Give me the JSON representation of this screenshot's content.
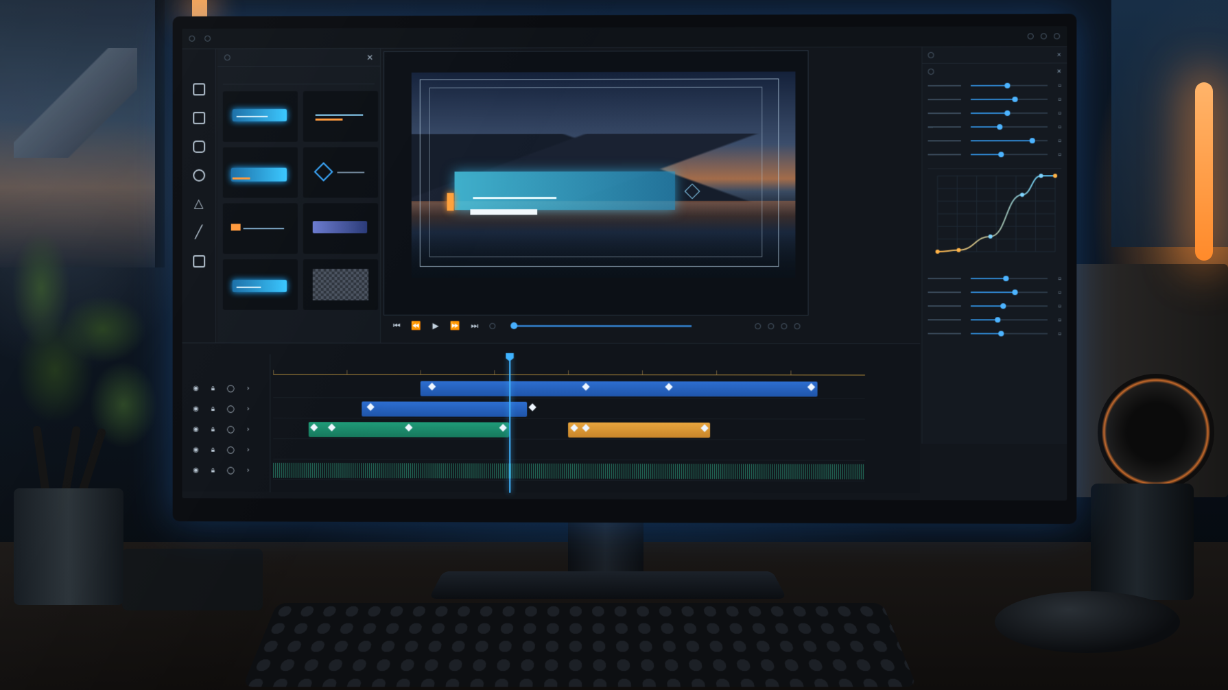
{
  "app": {
    "logo_label": "",
    "topbar_items": [
      "",
      "",
      ""
    ]
  },
  "tools": [
    {
      "name": "rectangle-tool",
      "glyph": ""
    },
    {
      "name": "square-tool",
      "glyph": ""
    },
    {
      "name": "rounded-rect-tool",
      "glyph": ""
    },
    {
      "name": "ellipse-tool",
      "glyph": ""
    },
    {
      "name": "triangle-tool",
      "glyph": "△"
    },
    {
      "name": "line-tool",
      "glyph": "╱"
    },
    {
      "name": "frame-tool",
      "glyph": ""
    }
  ],
  "transport": {
    "skip_back": "⏮",
    "step_back": "⏪",
    "play": "▶",
    "step_forward": "⏩",
    "skip_forward": "⏭",
    "scrub_position": 0.0
  },
  "timeline": {
    "tick_labels": [
      "",
      "",
      "",
      "",
      "",
      "",
      "",
      ""
    ],
    "playhead_fraction": 0.4,
    "tracks": [
      {
        "name": "track-1",
        "clips": [
          {
            "color": "blue",
            "start": 0.25,
            "end": 0.92,
            "keyframes": [
              0.27,
              0.53,
              0.67,
              0.91
            ]
          }
        ]
      },
      {
        "name": "track-2",
        "clips": [
          {
            "color": "blue",
            "start": 0.15,
            "end": 0.43,
            "keyframes": [
              0.165,
              0.44
            ]
          }
        ]
      },
      {
        "name": "track-3",
        "clips": [
          {
            "color": "green",
            "start": 0.06,
            "end": 0.4,
            "keyframes": [
              0.07,
              0.1,
              0.23,
              0.39
            ]
          },
          {
            "color": "orange",
            "start": 0.5,
            "end": 0.74,
            "keyframes": [
              0.51,
              0.53,
              0.73
            ]
          }
        ]
      },
      {
        "name": "track-4",
        "clips": []
      },
      {
        "name": "audio-track",
        "clips": []
      }
    ]
  },
  "properties": {
    "sliders": [
      0.48,
      0.58,
      0.48,
      0.38,
      0.8,
      0.4,
      0.46,
      0.58,
      0.42,
      0.35,
      0.4
    ],
    "curve_points": [
      [
        0.0,
        0.0
      ],
      [
        0.18,
        0.02
      ],
      [
        0.45,
        0.2
      ],
      [
        0.72,
        0.75
      ],
      [
        0.88,
        1.0
      ],
      [
        1.0,
        1.0
      ]
    ]
  },
  "colors": {
    "accent": "#3fb3ff",
    "clip_blue": "#2d6ed0",
    "clip_green": "#1f9b78",
    "clip_orange": "#e8a53d",
    "curve_orange": "#ffb347"
  }
}
